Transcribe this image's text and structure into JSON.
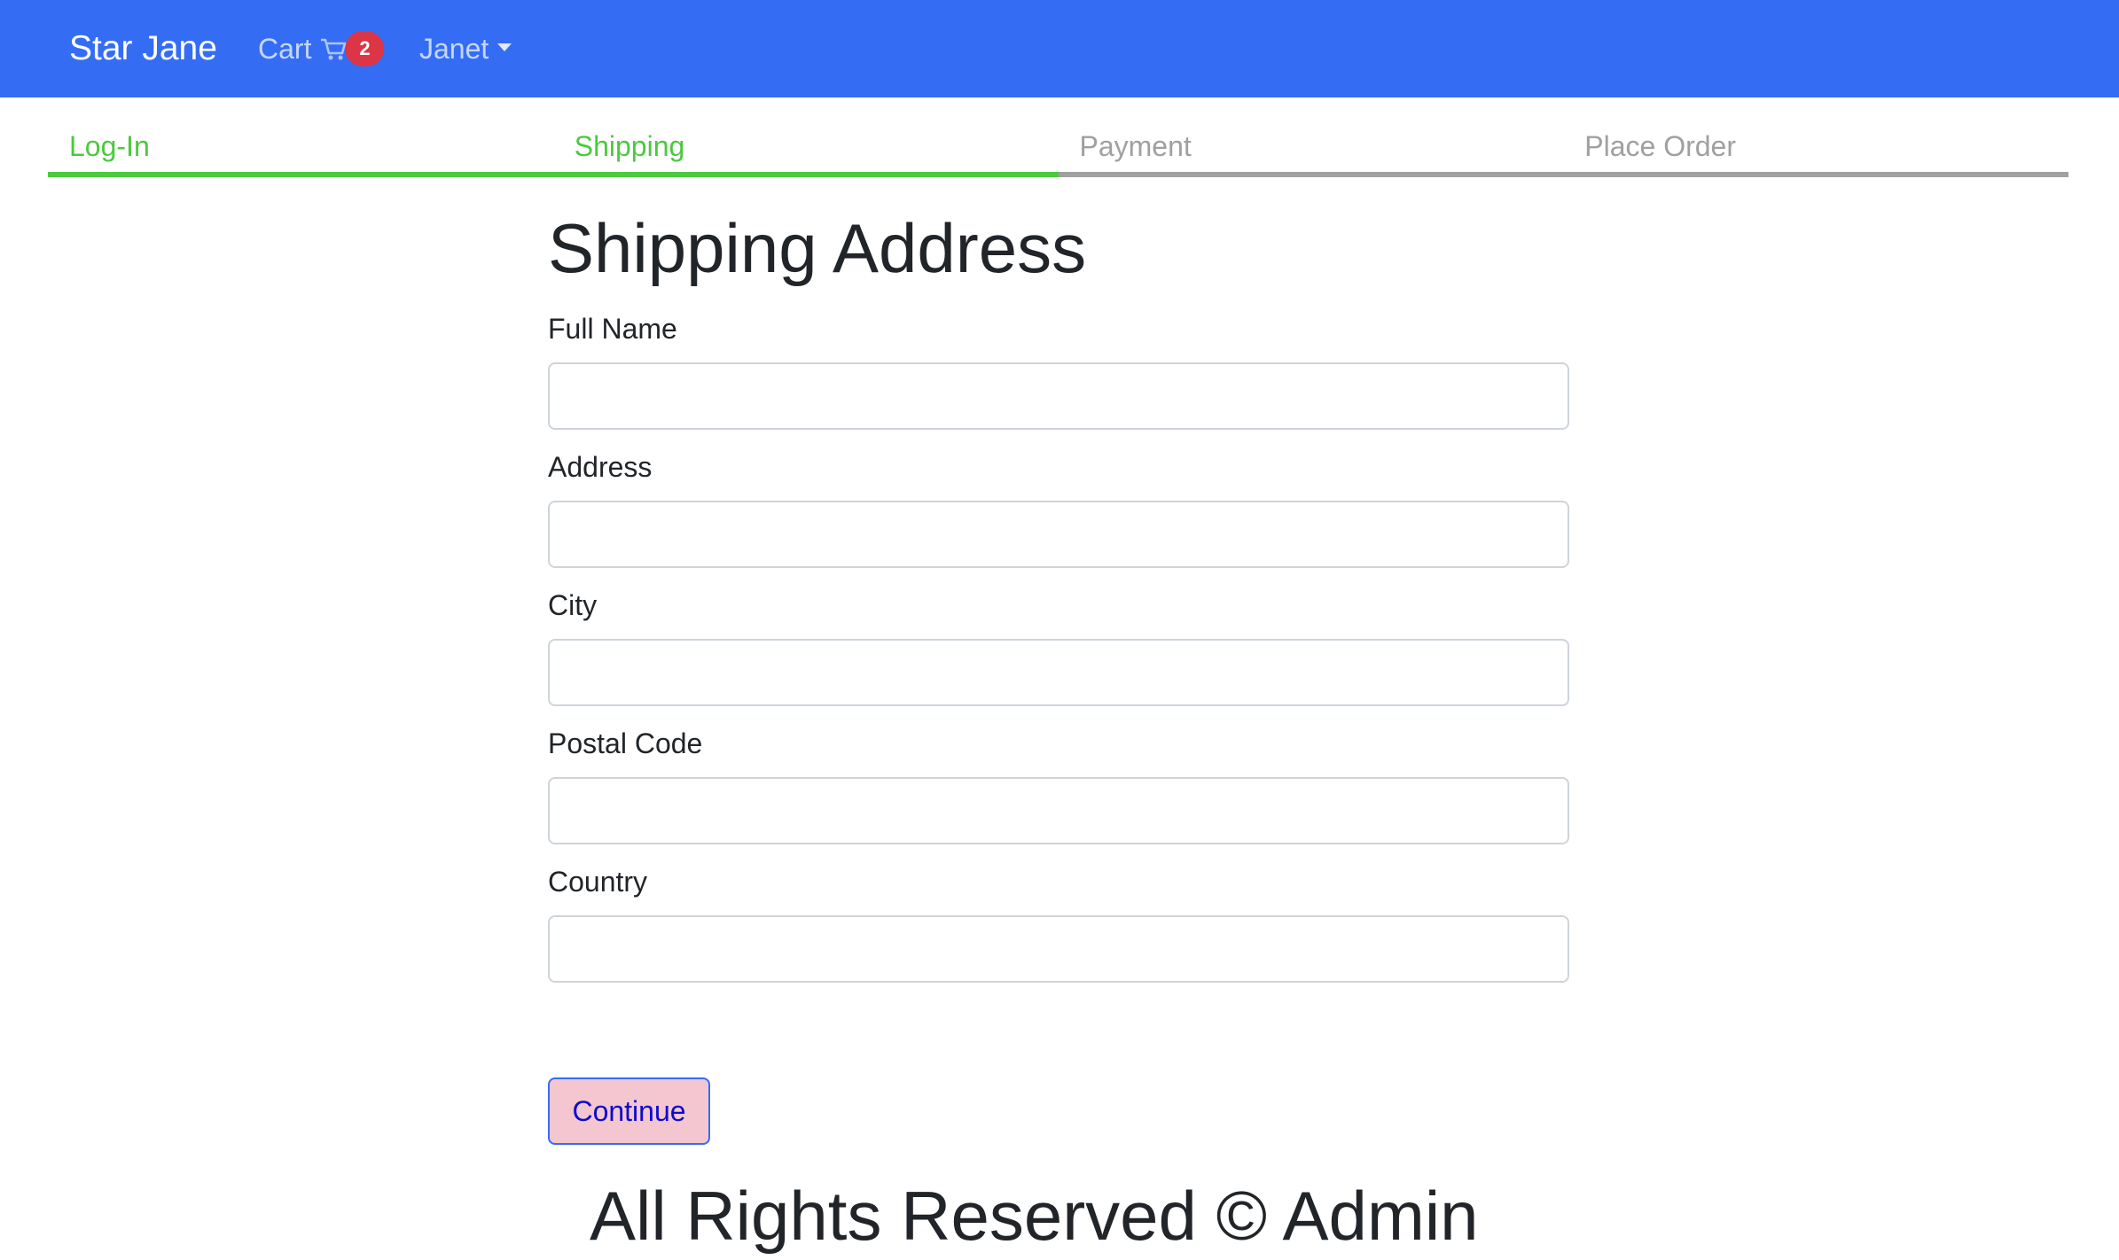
{
  "navbar": {
    "brand": "Star Jane",
    "cart_label": "Cart",
    "cart_icon": "shopping-cart-icon",
    "cart_count": "2",
    "user_label": "Janet",
    "colors": {
      "background": "#346df4",
      "badge": "#dc3545"
    }
  },
  "steps": [
    {
      "label": "Log-In",
      "active": true
    },
    {
      "label": "Shipping",
      "active": true
    },
    {
      "label": "Payment",
      "active": false
    },
    {
      "label": "Place Order",
      "active": false
    }
  ],
  "form": {
    "title": "Shipping Address",
    "fields": [
      {
        "label": "Full Name",
        "value": ""
      },
      {
        "label": "Address",
        "value": ""
      },
      {
        "label": "City",
        "value": ""
      },
      {
        "label": "Postal Code",
        "value": ""
      },
      {
        "label": "Country",
        "value": ""
      }
    ],
    "submit_label": "Continue"
  },
  "footer": {
    "text": "All Rights Reserved © Admin"
  },
  "colors": {
    "step_active": "#4cc93f",
    "step_inactive": "#a0a0a0",
    "button_bg": "#f4c6cf",
    "button_border": "#346df4"
  }
}
